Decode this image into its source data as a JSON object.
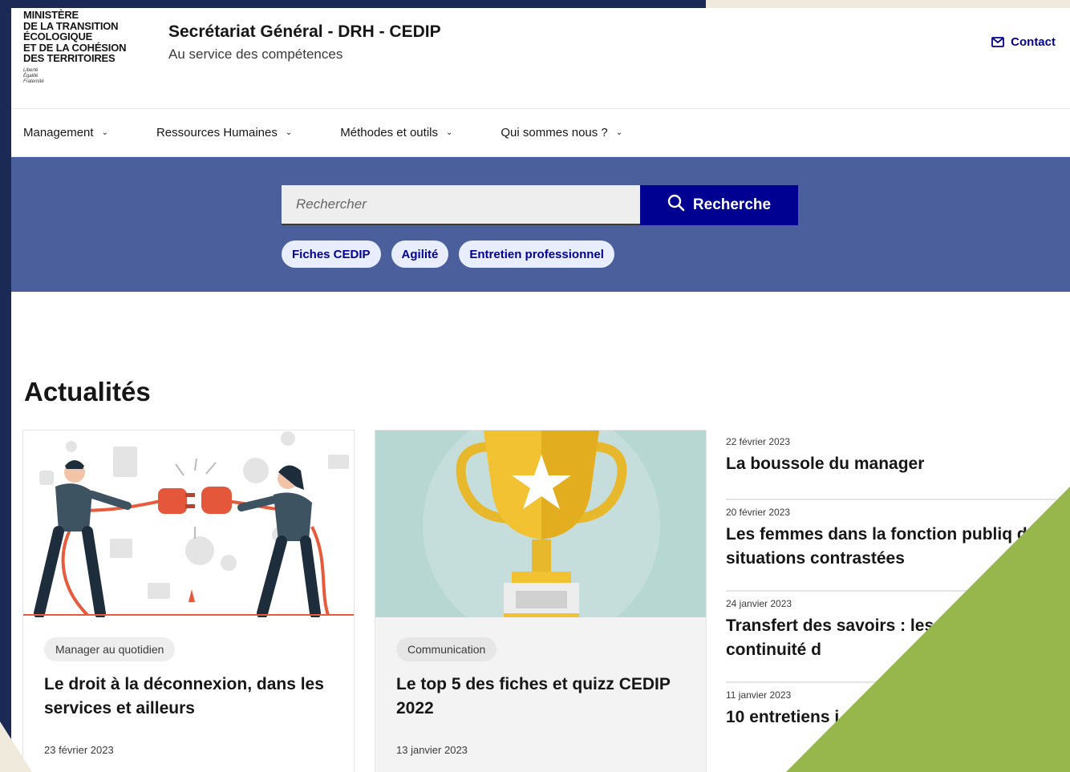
{
  "ministry": {
    "lines": [
      "MINISTÈRE",
      "DE LA TRANSITION",
      "ÉCOLOGIQUE",
      "ET DE LA COHÉSION",
      "DES TERRITOIRES"
    ],
    "motto": [
      "Liberté",
      "Égalité",
      "Fraternité"
    ]
  },
  "header": {
    "title": "Secrétariat Général - DRH - CEDIP",
    "tagline": "Au service des compétences",
    "contact_label": "Contact"
  },
  "nav": {
    "items": [
      {
        "label": "Management"
      },
      {
        "label": "Ressources Humaines"
      },
      {
        "label": "Méthodes et outils"
      },
      {
        "label": "Qui sommes nous ?"
      }
    ]
  },
  "search": {
    "placeholder": "Rechercher",
    "button_label": "Recherche",
    "tags": [
      "Fiches CEDIP",
      "Agilité",
      "Entretien professionnel"
    ]
  },
  "news": {
    "section_title": "Actualités",
    "cards": [
      {
        "category": "Manager au quotidien",
        "title": "Le droit à la déconnexion, dans les services et ailleurs",
        "date": "23 février 2023"
      },
      {
        "category": "Communication",
        "title": "Le top 5 des fiches et quizz CEDIP 2022",
        "date": "13 janvier 2023"
      }
    ],
    "list": [
      {
        "date": "22 février 2023",
        "title": "La boussole du manager"
      },
      {
        "date": "20 février 2023",
        "title": "Les femmes dans la fonction publiq des situations contrastées"
      },
      {
        "date": "24 janvier 2023",
        "title": "Transfert des savoirs : les assurer la continuité d"
      },
      {
        "date": "11 janvier 2023",
        "title": "10 entretiens i manager au"
      }
    ]
  },
  "colors": {
    "primary": "#000091",
    "band": "#4b5f9c",
    "frame": "#1b2a55",
    "accent_green": "#97b64c",
    "tag_bg": "#e8edff"
  }
}
